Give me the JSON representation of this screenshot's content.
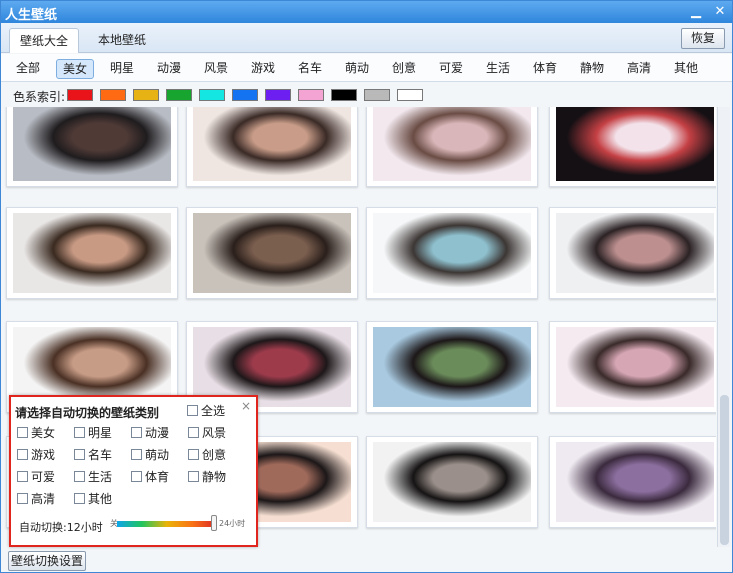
{
  "window": {
    "title": "人生壁纸",
    "minimize_glyph": "▁",
    "close_glyph": "✕"
  },
  "tabs": [
    {
      "label": "壁纸大全"
    },
    {
      "label": "本地壁纸"
    }
  ],
  "restore_label": "恢复",
  "categories": [
    "全部",
    "美女",
    "明星",
    "动漫",
    "风景",
    "游戏",
    "名车",
    "萌动",
    "创意",
    "可爱",
    "生活",
    "体育",
    "静物",
    "高清",
    "其他"
  ],
  "color_index": {
    "label": "色系索引:",
    "swatches": [
      "#e8141a",
      "#ff6a13",
      "#e7b213",
      "#17a52f",
      "#14e6e1",
      "#1473f0",
      "#6c1ff0",
      "#f3a4d3",
      "#000000",
      "#b9b9b9",
      "#ffffff"
    ]
  },
  "thumbnails": [
    [
      "#b8bcc4",
      "#4f3a36",
      "#1f1c1e"
    ],
    [
      "#efe6e2",
      "#c89c88",
      "#3a2a26"
    ],
    [
      "#f2e8ee",
      "#d9b6b9",
      "#6a4c44"
    ],
    [
      "#141014",
      "#f3e2ea",
      "#c44044"
    ],
    [
      "#e9e7e6",
      "#c89a84",
      "#3a2a20"
    ],
    [
      "#c9c2bb",
      "#7a5e4e",
      "#2a1f1b"
    ],
    [
      "#f5f7f8",
      "#8ec0ce",
      "#3c3634"
    ],
    [
      "#eff0f2",
      "#bd8f8f",
      "#2b2224"
    ],
    [
      "#f4f4f4",
      "#c79c86",
      "#4a3024"
    ],
    [
      "#e7dfe5",
      "#9d3b4b",
      "#1d1719"
    ],
    [
      "#a8c9e0",
      "#6a8b5a",
      "#1c1718"
    ],
    [
      "#f4eaf0",
      "#d6a6b4",
      "#3a2a2a"
    ],
    [
      "#eac3b4",
      "#b98b77",
      "#241c19"
    ],
    [
      "#f6dfd2",
      "#a06a5b",
      "#1c1718"
    ],
    [
      "#f2f2f2",
      "#9a8f8a",
      "#151313"
    ],
    [
      "#efeaf2",
      "#8c6f9f",
      "#3b2a3e"
    ]
  ],
  "settings_label": "壁纸切换设置",
  "popup": {
    "title": "请选择自动切换的壁纸类别",
    "select_all": "全选",
    "close_glyph": "×",
    "options": [
      "美女",
      "明星",
      "动漫",
      "风景",
      "游戏",
      "名车",
      "萌动",
      "创意",
      "可爱",
      "生活",
      "体育",
      "静物",
      "高清",
      "其他"
    ],
    "interval_label": "自动切换:12小时",
    "slider_min": "关",
    "slider_max": "24小时",
    "slider_value": 0.97
  }
}
